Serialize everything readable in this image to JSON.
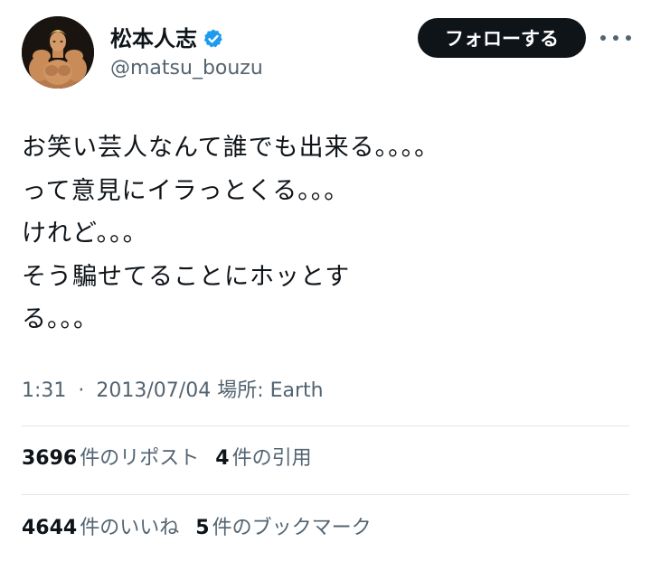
{
  "author": {
    "display_name": "松本人志",
    "handle": "@matsu_bouzu",
    "avatar_icon": "avatar-muscular-figure",
    "verified_icon": "verified-badge-icon",
    "verified_color": "#1d9bf0"
  },
  "actions": {
    "follow_label": "フォローする",
    "more_icon": "more-horizontal-icon"
  },
  "tweet": {
    "lines": [
      "お笑い芸人なんて誰でも出来る。。。。",
      "って意見にイラっとくる。。。",
      "けれど。。。",
      "そう騙せてることにホッとす",
      "る。。。"
    ],
    "time": "1:31",
    "separator": "·",
    "date": "2013/07/04",
    "location": "場所: Earth"
  },
  "stats": {
    "reposts": {
      "count": "3696",
      "label": "件のリポスト"
    },
    "quotes": {
      "count": "4",
      "label": "件の引用"
    },
    "likes": {
      "count": "4644",
      "label": "件のいいね"
    },
    "bookmarks": {
      "count": "5",
      "label": "件のブックマーク"
    }
  },
  "colors": {
    "text": "#0f1419",
    "secondary": "#536471",
    "divider": "#e1e6ea",
    "follow_bg": "#0f1419"
  }
}
